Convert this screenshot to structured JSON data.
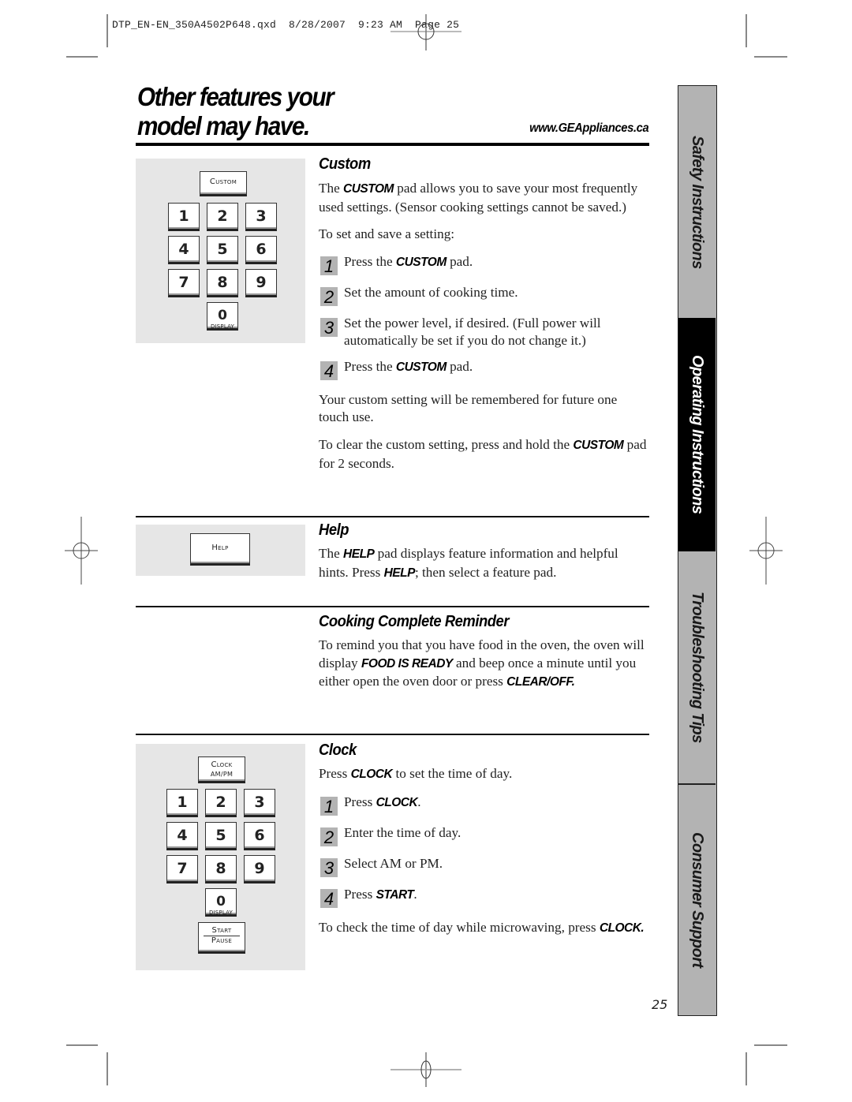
{
  "slug": "DTP_EN-EN_350A4502P648.qxd  8/28/2007  9:23 AM  Page 25",
  "header": {
    "title_line1": "Other features your",
    "title_line2": "model may have.",
    "website": "www.GEAppliances.ca"
  },
  "side_tabs": [
    {
      "label": "Safety Instructions",
      "active": false
    },
    {
      "label": "Operating Instructions",
      "active": true
    },
    {
      "label": "Troubleshooting Tips",
      "active": false
    },
    {
      "label": "Consumer Support",
      "active": false
    }
  ],
  "custom_keypad": {
    "function_key": "Custom",
    "digits": [
      "1",
      "2",
      "3",
      "4",
      "5",
      "6",
      "7",
      "8",
      "9"
    ],
    "zero": "0",
    "zero_sub": "DISPLAY"
  },
  "custom": {
    "heading": "Custom",
    "intro_pre": "The ",
    "intro_kw": "CUSTOM",
    "intro_post": " pad allows you to save your most frequently used settings. (Sensor cooking settings cannot be saved.)",
    "lead": "To set and save a setting:",
    "steps": [
      {
        "num": "1",
        "pre": "Press the ",
        "kw": "CUSTOM",
        "post": " pad."
      },
      {
        "num": "2",
        "pre": "Set the amount of cooking time.",
        "kw": "",
        "post": ""
      },
      {
        "num": "3",
        "pre": "Set the power level, if desired. (Full power will automatically be set if you do not change it.)",
        "kw": "",
        "post": ""
      },
      {
        "num": "4",
        "pre": "Press the ",
        "kw": "CUSTOM",
        "post": " pad."
      }
    ],
    "remember": "Your custom setting will be remembered for future one touch use.",
    "clear_pre": "To clear the custom setting, press and hold the ",
    "clear_kw": "CUSTOM",
    "clear_post": " pad for 2 seconds."
  },
  "help_key": "Help",
  "help": {
    "heading": "Help",
    "pre": "The ",
    "kw1": "HELP",
    "mid": " pad displays feature information and helpful hints. Press ",
    "kw2": "HELP",
    "post": "; then select a feature pad."
  },
  "reminder": {
    "heading": "Cooking Complete Reminder",
    "pre": "To remind you that you have food in the oven, the oven will display ",
    "kw1": "FOOD IS READY",
    "mid": " and beep once a minute until you either open the oven door or press ",
    "kw2": "CLEAR/OFF."
  },
  "clock_keypad": {
    "function_key_line1": "Clock",
    "function_key_line2": "AM/PM",
    "digits": [
      "1",
      "2",
      "3",
      "4",
      "5",
      "6",
      "7",
      "8",
      "9"
    ],
    "zero": "0",
    "zero_sub": "DISPLAY",
    "start_line1": "Start",
    "start_line2": "Pause"
  },
  "clock": {
    "heading": "Clock",
    "intro_pre": "Press ",
    "intro_kw": "CLOCK",
    "intro_post": " to set the time of day.",
    "steps": [
      {
        "num": "1",
        "pre": "Press ",
        "kw": "CLOCK",
        "post": "."
      },
      {
        "num": "2",
        "pre": "Enter the time of day.",
        "kw": "",
        "post": ""
      },
      {
        "num": "3",
        "pre": "Select AM or PM.",
        "kw": "",
        "post": ""
      },
      {
        "num": "4",
        "pre": "Press ",
        "kw": "START",
        "post": "."
      }
    ],
    "check_pre": "To check the time of day while microwaving, press ",
    "check_kw": "CLOCK."
  },
  "page_number": "25"
}
